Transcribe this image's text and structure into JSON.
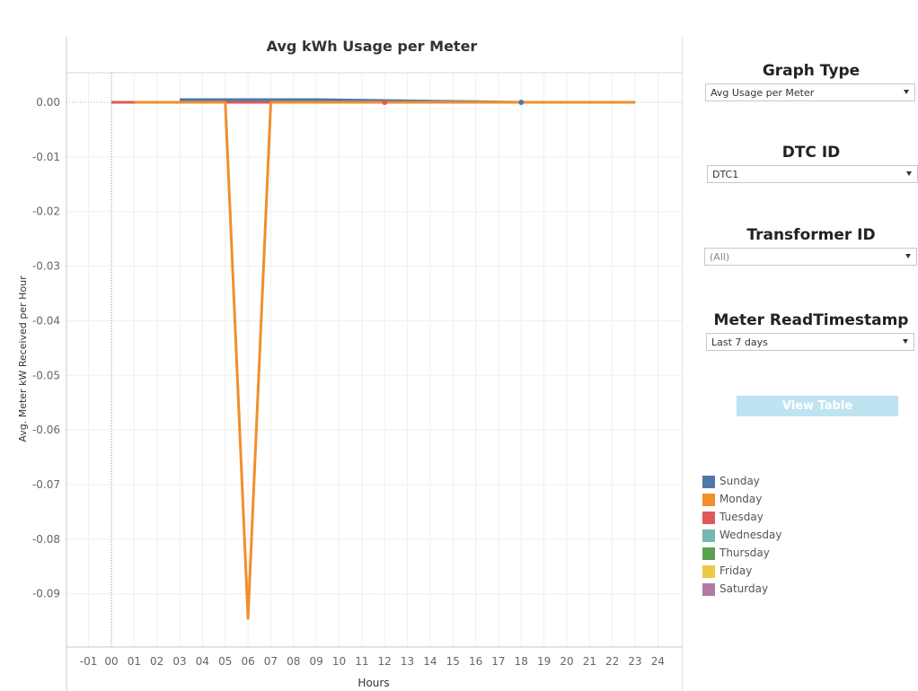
{
  "chart_data": {
    "type": "line",
    "title": "Avg kWh Usage per Meter",
    "xlabel": "Hours",
    "ylabel": "Avg. Meter kW Received per Hour",
    "xlim": [
      -1,
      24
    ],
    "ylim": [
      -0.099,
      0.0055
    ],
    "x_ticks": [
      "-01",
      "00",
      "01",
      "02",
      "03",
      "04",
      "05",
      "06",
      "07",
      "08",
      "09",
      "10",
      "11",
      "12",
      "13",
      "14",
      "15",
      "16",
      "17",
      "18",
      "19",
      "20",
      "21",
      "22",
      "23",
      "24"
    ],
    "y_ticks": [
      "0.00",
      "-0.01",
      "-0.02",
      "-0.03",
      "-0.04",
      "-0.05",
      "-0.06",
      "-0.07",
      "-0.08",
      "-0.09"
    ],
    "grid": true,
    "series": [
      {
        "name": "Sunday",
        "color": "#4e79a7",
        "points": [
          [
            3,
            0.0005
          ],
          [
            9,
            0.0005
          ],
          [
            18,
            0
          ]
        ]
      },
      {
        "name": "Tuesday",
        "color": "#e15759",
        "points": [
          [
            0,
            0
          ],
          [
            1,
            0
          ],
          [
            5,
            0
          ],
          [
            7,
            0
          ]
        ]
      },
      {
        "name": "Monday",
        "color": "#f28e2b",
        "points": [
          [
            1,
            0
          ],
          [
            2,
            0
          ],
          [
            3,
            0
          ],
          [
            4,
            0
          ],
          [
            5,
            0
          ],
          [
            6,
            -0.0945
          ],
          [
            7,
            0
          ],
          [
            8,
            0
          ],
          [
            9,
            0
          ],
          [
            10,
            0
          ],
          [
            11,
            0
          ],
          [
            12,
            0
          ],
          [
            13,
            0
          ],
          [
            14,
            0
          ],
          [
            15,
            0
          ],
          [
            16,
            0
          ],
          [
            17,
            0
          ],
          [
            18,
            0
          ],
          [
            19,
            0
          ],
          [
            20,
            0
          ],
          [
            21,
            0
          ],
          [
            22,
            0
          ],
          [
            23,
            0
          ]
        ]
      }
    ],
    "markers": [
      {
        "series": "Tuesday",
        "x": 12,
        "y": 0,
        "color": "#e15759"
      },
      {
        "series": "Sunday",
        "x": 18,
        "y": 0,
        "color": "#4e79a7"
      }
    ]
  },
  "controls": {
    "graph_type": {
      "title": "Graph Type",
      "value": "Avg Usage per Meter"
    },
    "dtc_id": {
      "title": "DTC ID",
      "value": "DTC1"
    },
    "transformer_id": {
      "title": "Transformer ID",
      "value": "(All)"
    },
    "meter_read_timestamp": {
      "title": "Meter ReadTimestamp",
      "value": "Last 7 days"
    },
    "view_table_label": "View Table"
  },
  "legend": {
    "items": [
      {
        "label": "Sunday",
        "color": "#4e79a7"
      },
      {
        "label": "Monday",
        "color": "#f28e2b"
      },
      {
        "label": "Tuesday",
        "color": "#e15759"
      },
      {
        "label": "Wednesday",
        "color": "#76b7b2"
      },
      {
        "label": "Thursday",
        "color": "#59a14f"
      },
      {
        "label": "Friday",
        "color": "#edc948"
      },
      {
        "label": "Saturday",
        "color": "#b07aa1"
      }
    ]
  }
}
